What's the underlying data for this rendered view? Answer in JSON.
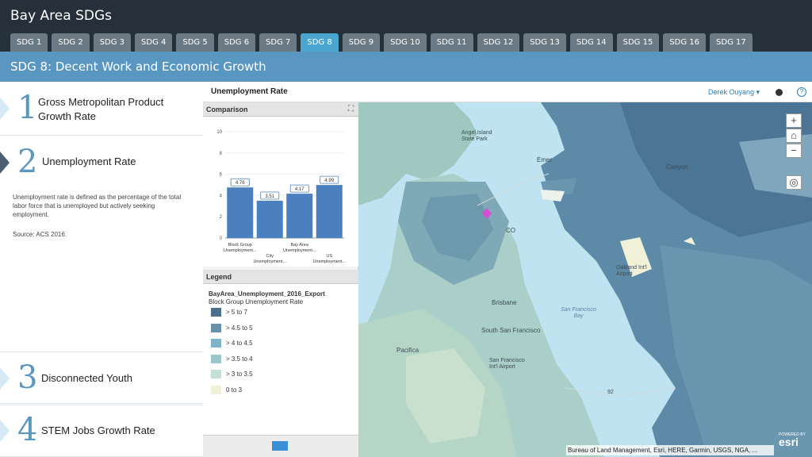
{
  "app": {
    "title": "Bay Area SDGs"
  },
  "tabs": [
    "SDG 1",
    "SDG 2",
    "SDG 3",
    "SDG 4",
    "SDG 5",
    "SDG 6",
    "SDG 7",
    "SDG 8",
    "SDG 9",
    "SDG 10",
    "SDG 11",
    "SDG 12",
    "SDG 13",
    "SDG 14",
    "SDG 15",
    "SDG 16",
    "SDG 17"
  ],
  "active_tab": "SDG 8",
  "banner": {
    "title": "SDG 8: Decent Work and Economic Growth"
  },
  "indicators": [
    {
      "num": "1",
      "label": "Gross Metropolitan Product Growth Rate"
    },
    {
      "num": "2",
      "label": "Unemployment Rate"
    },
    {
      "num": "3",
      "label": "Disconnected Youth"
    },
    {
      "num": "4",
      "label": "STEM Jobs Growth Rate"
    }
  ],
  "description": "Unemployment rate is defined as the percentage of the total labor force that is unemployed but actively seeking employment.",
  "source": "Source: ACS 2016.",
  "panel": {
    "title": "Unemployment Rate",
    "user": "Derek Ouyang ▾",
    "help": "?"
  },
  "comparison": {
    "title": "Comparison"
  },
  "chart_data": {
    "type": "bar",
    "categories": [
      "Block Group Unemployment...",
      "City Unemployment...",
      "Bay Area Unemployment...",
      "US Unemployment..."
    ],
    "values": [
      4.76,
      3.51,
      4.17,
      4.99
    ],
    "value_labels": [
      "4.76",
      "3.51",
      "4.17",
      "4.99"
    ],
    "y_ticks": [
      0,
      2,
      4,
      6,
      8,
      10
    ],
    "ylim": [
      0,
      10
    ],
    "bar_color": "#4a7fc0"
  },
  "legend": {
    "title": "Legend",
    "layer": "BayArea_Unemployment_2016_Export",
    "field": "Block Group Unemployment Rate",
    "items": [
      {
        "label": "> 5 to 7",
        "color": "#4c6f8c"
      },
      {
        "label": "> 4.5 to 5",
        "color": "#6a8fa8"
      },
      {
        "label": "> 4 to 4.5",
        "color": "#7fb3c7"
      },
      {
        "label": "> 3.5 to 4",
        "color": "#9ac6cc"
      },
      {
        "label": "> 3 to 3.5",
        "color": "#c4dfd3"
      },
      {
        "label": "0 to 3",
        "color": "#f1f1d9"
      }
    ]
  },
  "map": {
    "labels": {
      "angel_island": "Angel Island State Park",
      "emeryville": "Emer",
      "canyon": "Canyon",
      "sf": "CO",
      "oakland_airport": "Oakland Int'l Airport",
      "brisbane": "Brisbane",
      "south_sf": "South San Francisco",
      "sf_bay": "San Francisco Bay",
      "sfo": "San Francisco Int'l Airport",
      "pacifica": "Pacifica",
      "highway": "92"
    },
    "attribution": "Bureau of Land Management, Esri, HERE, Garmin, USGS, NGA, ...",
    "powered_by": "POWERED BY",
    "esri": "esri",
    "controls": {
      "zoom_in": "+",
      "home": "⌂",
      "zoom_out": "−",
      "locate": "◎"
    }
  }
}
